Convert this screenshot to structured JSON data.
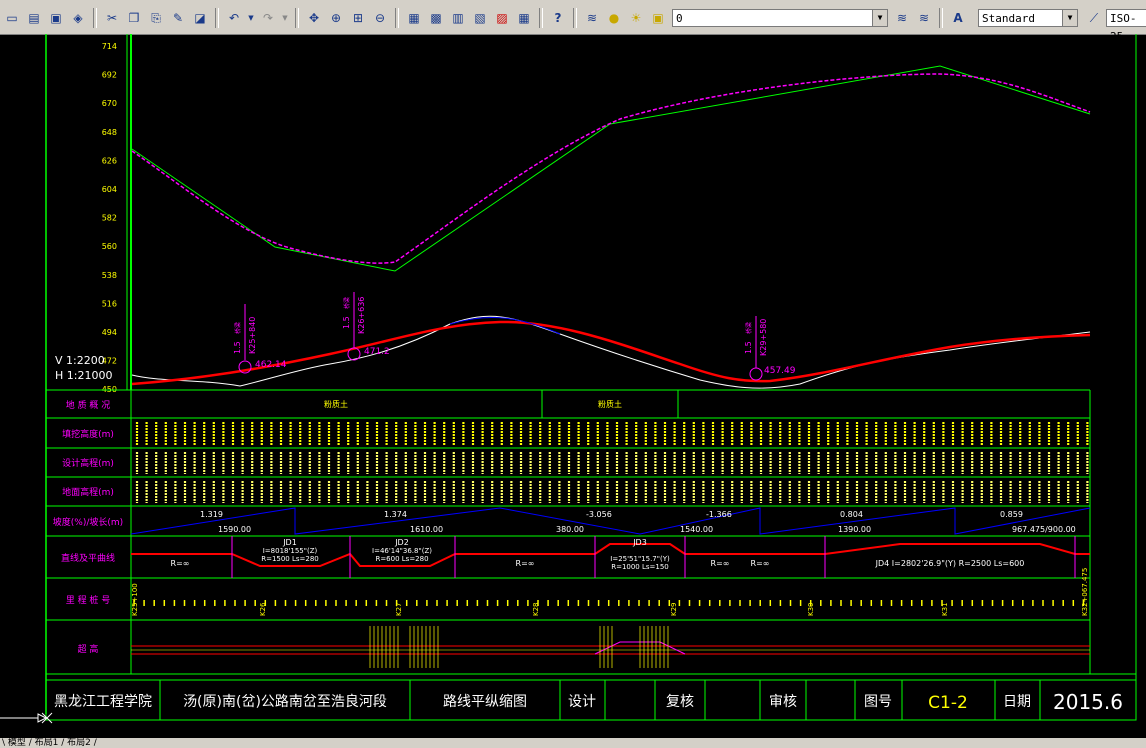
{
  "toolbar": {
    "layer_value": "0",
    "text_style": "Standard",
    "dim_style": "ISO-25"
  },
  "profile": {
    "y_ticks": [
      "714",
      "692",
      "670",
      "648",
      "626",
      "604",
      "582",
      "560",
      "538",
      "516",
      "494",
      "472",
      "450"
    ],
    "scale_v": "V 1:2200",
    "scale_h": "H 1:21000",
    "points": [
      {
        "label": "462.14"
      },
      {
        "label": "471.2"
      },
      {
        "label": "457.49"
      }
    ],
    "bridges": [
      {
        "line1": "1.5",
        "line2": "桥梁",
        "line3": "K25+840"
      },
      {
        "line1": "1.5",
        "line2": "桥梁",
        "line3": "K26+636"
      },
      {
        "line1": "1.5",
        "line2": "桥梁",
        "line3": "K29+580"
      }
    ]
  },
  "rows": {
    "geology": "地 质 概 况",
    "fill_cut": "填挖高度(m)",
    "design_elev": "设计高程(m)",
    "ground_elev": "地面高程(m)",
    "slope": "坡度(%)/坡长(m)",
    "curves": "直线及平曲线",
    "stations": "里 程 桩 号",
    "superelev": "超      高"
  },
  "geology_cells": [
    "粉质土",
    "粉质土"
  ],
  "slope_cells": [
    {
      "top": "1.319",
      "bottom": "1590.00"
    },
    {
      "top": "1.374",
      "bottom": "1610.00"
    },
    {
      "top": "-3.056",
      "bottom": "380.00"
    },
    {
      "top": "-1.366",
      "bottom": "1540.00"
    },
    {
      "top": "0.804",
      "bottom": "1390.00"
    },
    {
      "top": "0.859",
      "bottom": "967.475/900.00"
    }
  ],
  "curve_labels": [
    {
      "name": "R=∞"
    },
    {
      "name": "JD1",
      "detail": "I=8018'155\"(Z)",
      "detail2": "R=1500  Ls=280"
    },
    {
      "name": "JD2",
      "detail": "I=46'14\"36.8\"(Z)",
      "detail2": "R=600  Ls=280"
    },
    {
      "name": "R=∞"
    },
    {
      "name": "JD3",
      "detail": "I=25'51\"15.7\"(Y)",
      "detail2": "R=1000  Ls=150"
    },
    {
      "name": "R=∞"
    },
    {
      "name": "R=∞"
    },
    {
      "name": "JD4  I=2802'26.9\"(Y)  R=2500  Ls=600"
    }
  ],
  "station_labels": [
    "K25+100",
    "K26",
    "K27",
    "K28",
    "K29",
    "K30",
    "K31",
    "K32+067.475"
  ],
  "title_block": {
    "institute": "黑龙江工程学院",
    "project": "汤(原)南(岔)公路南岔至浩良河段",
    "drawing_name": "路线平纵缩图",
    "design": "设计",
    "review": "复核",
    "approve": "审核",
    "drawing_no_label": "图号",
    "drawing_no": "C1-2",
    "date_label": "日期",
    "date": "2015.6"
  },
  "status": {
    "tabs": "\\ 模型 / 布局1 / 布局2 /"
  },
  "colors": {
    "frame": "#00ff00",
    "design_line": "#ff0000",
    "ground_line": "#ffffff",
    "text_yellow": "#ffff00",
    "text_magenta": "#ff00ff",
    "slope_blue": "#0000ff"
  }
}
